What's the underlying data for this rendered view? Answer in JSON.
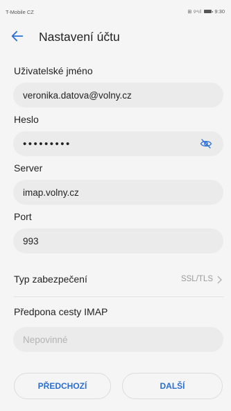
{
  "status_bar": {
    "carrier": "T-Mobile CZ",
    "signal": "⊞ ᵍ⁴ıl",
    "time": "9:30"
  },
  "app_bar": {
    "title": "Nastavení účtu"
  },
  "fields": {
    "username": {
      "label": "Uživatelské jméno",
      "value": "veronika.datova@volny.cz"
    },
    "password": {
      "label": "Heslo",
      "value": "•••••••••"
    },
    "server": {
      "label": "Server",
      "value": "imap.volny.cz"
    },
    "port": {
      "label": "Port",
      "value": "993"
    }
  },
  "security": {
    "label": "Typ zabezpečení",
    "value": "SSL/TLS"
  },
  "imap_prefix": {
    "label": "Předpona cesty IMAP",
    "placeholder": "Nepovinné"
  },
  "buttons": {
    "prev": "PŘEDCHOZÍ",
    "next": "DALŠÍ"
  },
  "colors": {
    "accent": "#2a6fd4",
    "field_bg": "#ebebeb",
    "page_bg": "#f5f5f5"
  }
}
